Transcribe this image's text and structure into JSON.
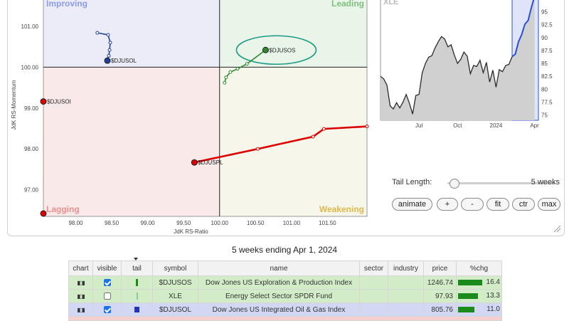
{
  "chart_data": [
    {
      "type": "scatter",
      "subtype": "relative-rotation-graph",
      "xlabel": "JdK RS-Ratio",
      "ylabel": "JdK RS-Momentum",
      "xlim": [
        97.55,
        102.05
      ],
      "ylim": [
        96.35,
        101.8
      ],
      "x_ticks": [
        "98.00",
        "98.50",
        "99.00",
        "99.50",
        "100.00",
        "100.50",
        "101.00",
        "101.50"
      ],
      "y_ticks": [
        "97.00",
        "98.00",
        "99.00",
        "100.00",
        "101.00"
      ],
      "quadrants": {
        "top_left": "Improving",
        "top_right": "Leading",
        "bottom_left": "Lagging",
        "bottom_right": "Weakening"
      },
      "quadrant_colors": {
        "improving": "#ececf8",
        "leading": "#eaf5ea",
        "lagging": "#f9e9e9",
        "weakening": "#f7f6ea"
      },
      "series": [
        {
          "name": "$DJUSOS",
          "color": "#2e8b2e",
          "points": [
            [
              100.07,
              99.62
            ],
            [
              100.09,
              99.75
            ],
            [
              100.15,
              99.88
            ],
            [
              100.25,
              99.96
            ],
            [
              100.38,
              100.08
            ],
            [
              100.64,
              100.42
            ]
          ]
        },
        {
          "name": "$DJUSOL",
          "color": "#1f3f9a",
          "points": [
            [
              98.3,
              100.84
            ],
            [
              98.45,
              100.79
            ],
            [
              98.48,
              100.6
            ],
            [
              98.47,
              100.42
            ],
            [
              98.46,
              100.28
            ],
            [
              98.44,
              100.16
            ]
          ]
        },
        {
          "name": "$DJUSPL",
          "color": "#dd0000",
          "points": [
            [
              102.05,
              98.55
            ],
            [
              101.45,
              98.49
            ],
            [
              101.3,
              98.3
            ],
            [
              100.53,
              98.0
            ],
            [
              99.65,
              97.67
            ]
          ]
        },
        {
          "name": "$DJUSOI",
          "color": "#dd0000",
          "points": [
            [
              97.55,
              99.16
            ]
          ]
        },
        {
          "name": "",
          "color": "#dd0000",
          "points": [
            [
              97.55,
              96.42
            ]
          ]
        }
      ],
      "highlight": "$DJUSOS",
      "highlight_color": "#1b9a85"
    },
    {
      "type": "line",
      "subtype": "price",
      "title": "XLE",
      "x_ticks": [
        "Jul",
        "Oct",
        "2024",
        "Apr"
      ],
      "x_tick_positions": [
        3.0,
        6.0,
        9.0,
        12.0
      ],
      "xlim": [
        0,
        12.3
      ],
      "y_ticks": [
        "75",
        "77.5",
        "80",
        "82.5",
        "85",
        "87.5",
        "90",
        "92.5",
        "95"
      ],
      "ylim": [
        74.0,
        98.5
      ],
      "last_value": "97.93",
      "x": [
        0,
        0.25,
        0.5,
        0.75,
        1.0,
        1.25,
        1.5,
        1.75,
        2.0,
        2.25,
        2.5,
        2.75,
        3.0,
        3.25,
        3.5,
        3.75,
        4.0,
        4.25,
        4.5,
        4.75,
        5.0,
        5.25,
        5.5,
        5.75,
        6.0,
        6.25,
        6.5,
        6.75,
        7.0,
        7.25,
        7.5,
        7.75,
        8.0,
        8.25,
        8.5,
        8.75,
        9.0,
        9.25,
        9.5,
        9.75,
        10.0,
        10.25,
        10.5,
        10.75,
        11.0,
        11.25,
        11.5,
        11.75,
        12.0
      ],
      "values": [
        82.5,
        82.0,
        80.8,
        76.8,
        76.2,
        77.4,
        76.4,
        77.5,
        79.0,
        77.3,
        75.2,
        78.8,
        79.0,
        83.2,
        85.0,
        86.2,
        86.5,
        88.0,
        89.2,
        90.2,
        89.7,
        88.2,
        88.6,
        86.6,
        85.0,
        85.8,
        87.2,
        86.4,
        83.0,
        84.6,
        84.4,
        85.6,
        83.2,
        85.2,
        81.4,
        83.7,
        80.4,
        83.8,
        83.4,
        84.6,
        84.8,
        86.3,
        86.8,
        89.2,
        90.6,
        92.6,
        93.3,
        95.8,
        97.93
      ],
      "series_color": "#2a2a2a",
      "fill_color": "#d0d0d0",
      "tail_highlight_color": "#2a4fd6",
      "tail_start": 10.25
    }
  ],
  "controls": {
    "tail_length_label": "Tail Length:",
    "tail_length_value": "5 weeks",
    "tail_slider_level": 0.06,
    "buttons": [
      "animate",
      "+",
      "-",
      "fit",
      "ctr",
      "max"
    ]
  },
  "subtitle": "5 weeks ending Apr 1, 2024",
  "table": {
    "headers": [
      "chart",
      "visible",
      "tail",
      "symbol",
      "name",
      "sector",
      "industry",
      "price",
      "%chg"
    ],
    "rows": [
      {
        "symbol": "$DJUSOS",
        "name": "Dow Jones US Exploration & Production Index",
        "sector": "",
        "industry": "",
        "price": "1246.74",
        "chg": "16.4",
        "chg_value": 16.4,
        "visible": true,
        "tail_color": "#1a8a1a",
        "row_class": "row-green"
      },
      {
        "symbol": "XLE",
        "name": "Energy Select Sector SPDR Fund",
        "sector": "",
        "industry": "",
        "price": "97.93",
        "chg": "13.3",
        "chg_value": 13.3,
        "visible": false,
        "tail_color": "#8fc98f",
        "row_class": "row-green"
      },
      {
        "symbol": "$DJUSOL",
        "name": "Dow Jones US Integrated Oil & Gas Index",
        "sector": "",
        "industry": "",
        "price": "805.76",
        "chg": "11.0",
        "chg_value": 11.0,
        "visible": true,
        "tail_color": "#2233bb",
        "row_class": "row-blue"
      }
    ],
    "chg_scale_max": 16.4
  }
}
